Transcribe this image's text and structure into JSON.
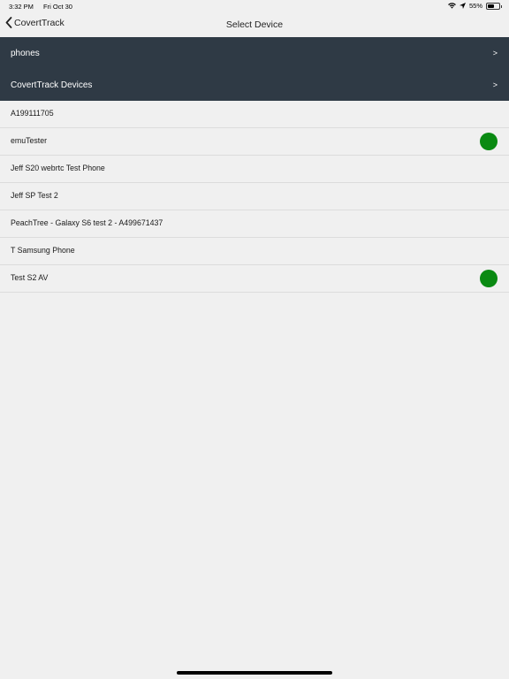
{
  "status_bar": {
    "time": "3:32 PM",
    "date": "Fri Oct 30",
    "battery_percent": "55%",
    "battery_level": 0.55,
    "icons": [
      "wifi-icon",
      "location-icon",
      "battery-icon"
    ]
  },
  "nav": {
    "back_label": "CovertTrack",
    "title": "Select Device"
  },
  "sections": [
    {
      "label": "phones",
      "chevron": ">"
    },
    {
      "label": "CovertTrack Devices",
      "chevron": ">"
    }
  ],
  "devices": [
    {
      "name": "A199111705",
      "online": false
    },
    {
      "name": "emuTester",
      "online": true
    },
    {
      "name": "Jeff S20 webrtc Test Phone",
      "online": false
    },
    {
      "name": "Jeff SP Test 2",
      "online": false
    },
    {
      "name": "PeachTree - Galaxy S6 test 2 - A499671437",
      "online": false
    },
    {
      "name": "T Samsung Phone",
      "online": false
    },
    {
      "name": "Test S2 AV",
      "online": true
    }
  ],
  "colors": {
    "header_bg": "#2f3a45",
    "online_dot": "#0a8a12",
    "background": "#f0f0f0"
  }
}
